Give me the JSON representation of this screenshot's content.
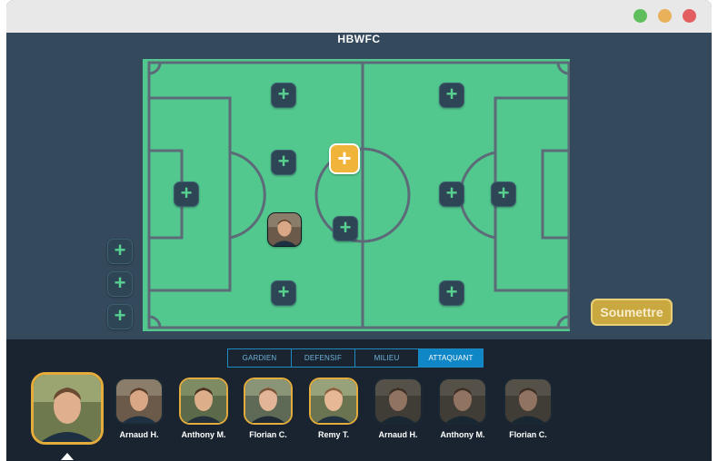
{
  "window": {
    "team_name": "HBWFC"
  },
  "colors": {
    "pitch": "#52c88f",
    "pitch_lines": "#5d6a78",
    "active_slot": "#f0b43a",
    "submit": "#c9a93f",
    "tab_accent": "#0f86c6"
  },
  "actions": {
    "submit_label": "Soumettre",
    "add_icon": "+"
  },
  "tabs": [
    {
      "label": "GARDIEN",
      "selected": false
    },
    {
      "label": "DEFENSIF",
      "selected": false
    },
    {
      "label": "MILIEU",
      "selected": false
    },
    {
      "label": "ATTAQUANT",
      "selected": true
    }
  ],
  "players": [
    {
      "name": "",
      "selected": true
    },
    {
      "name": "Arnaud H."
    },
    {
      "name": "Anthony M."
    },
    {
      "name": "Florian C."
    },
    {
      "name": "Remy T."
    },
    {
      "name": "Arnaud H."
    },
    {
      "name": "Anthony M."
    },
    {
      "name": "Florian C."
    }
  ]
}
